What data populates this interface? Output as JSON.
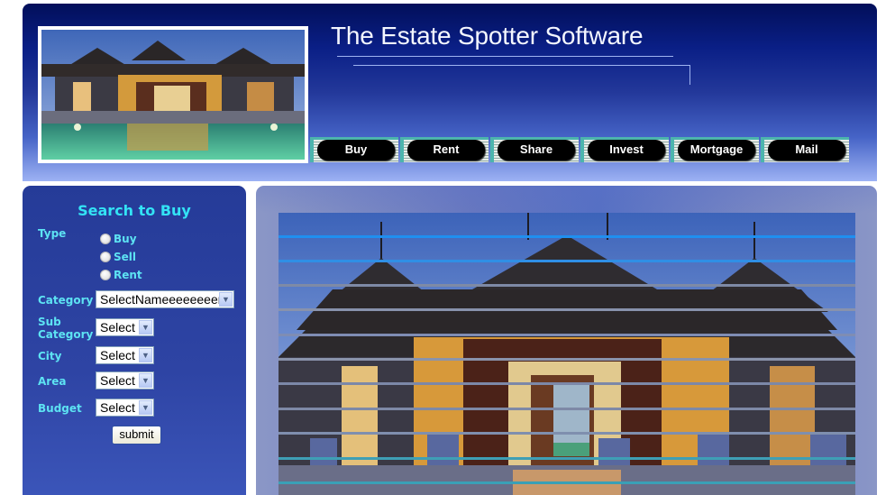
{
  "header": {
    "title": "The Estate Spotter Software",
    "photo_alt": "Luxury villa with pool at dusk"
  },
  "nav": {
    "items": [
      {
        "label": "Buy"
      },
      {
        "label": "Rent"
      },
      {
        "label": "Share"
      },
      {
        "label": "Invest"
      },
      {
        "label": "Mortgage"
      },
      {
        "label": "Mail"
      }
    ]
  },
  "search": {
    "title": "Search to Buy",
    "type_label": "Type",
    "type_options": [
      "Buy",
      "Sell",
      "Rent"
    ],
    "category_label": "Category",
    "category_value": "SelectNameeeeeeeer",
    "subcategory_label_line1": "Sub",
    "subcategory_label_line2": "Category",
    "subcategory_value": "Select",
    "city_label": "City",
    "city_value": "Select",
    "area_label": "Area",
    "area_value": "Select",
    "budget_label": "Budget",
    "budget_value": "Select",
    "submit_label": "submit"
  },
  "main": {
    "slideshow_alt": "Villa exterior slideshow (transition effect)"
  },
  "icons": {
    "dropdown_arrow": "chevron-down-icon",
    "radio": "radio-unchecked"
  }
}
